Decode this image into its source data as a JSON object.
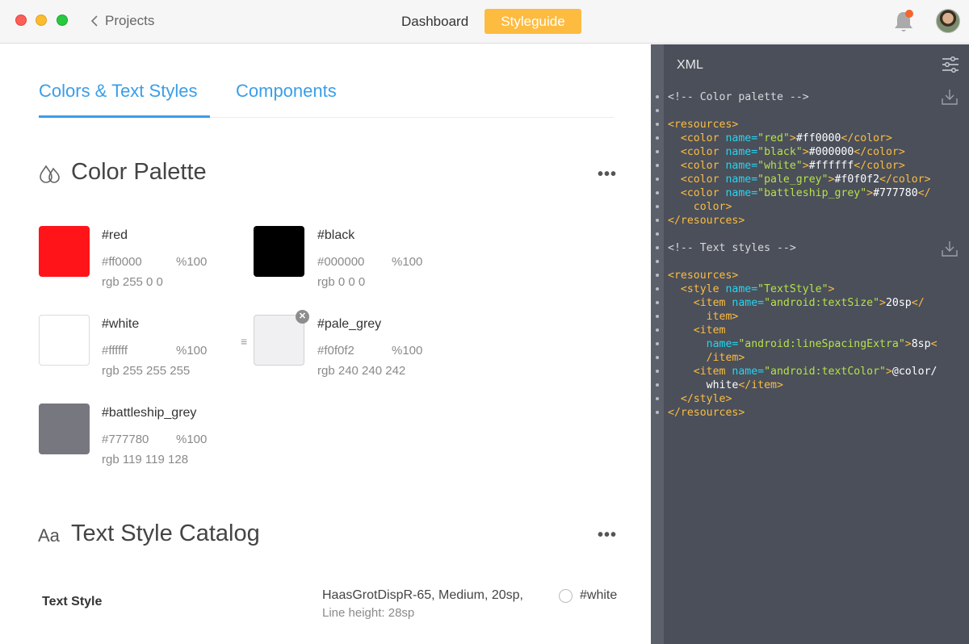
{
  "window": {
    "back_label": "Projects",
    "nav": [
      "Dashboard",
      "Styleguide"
    ]
  },
  "tabs": [
    "Colors & Text Styles",
    "Components"
  ],
  "color_palette": {
    "title": "Color Palette",
    "more": "•••",
    "colors": [
      {
        "name": "#red",
        "hex_label": "#ff0000",
        "opacity": "%100",
        "rgb": "rgb 255 0 0",
        "swatch": "#ff141a"
      },
      {
        "name": "#black",
        "hex_label": "#000000",
        "opacity": "%100",
        "rgb": "rgb 0 0 0",
        "swatch": "#000000"
      },
      {
        "name": "#white",
        "hex_label": "#ffffff",
        "opacity": "%100",
        "rgb": "rgb 255 255 255",
        "swatch": "#ffffff"
      },
      {
        "name": "#pale_grey",
        "hex_label": "#f0f0f2",
        "opacity": "%100",
        "rgb": "rgb 240 240 242",
        "swatch": "#f0f0f2"
      },
      {
        "name": "#battleship_grey",
        "hex_label": "#777780",
        "opacity": "%100",
        "rgb": "rgb 119 119 128",
        "swatch": "#777780"
      }
    ]
  },
  "text_catalog": {
    "title": "Text Style Catalog",
    "icon_text": "Aa",
    "more": "•••",
    "style": {
      "name": "Text Style",
      "font": "HaasGrotDispR-65, Medium, 20sp,",
      "line_height": "Line height: 28sp",
      "color": "#white"
    }
  },
  "xml_panel": {
    "title": "XML",
    "code_lines": [
      [
        [
          "c",
          "<!-- Color palette -->"
        ]
      ],
      [],
      [
        [
          "t",
          "<resources>"
        ]
      ],
      [
        [
          "v",
          "  "
        ],
        [
          "t",
          "<color "
        ],
        [
          "a",
          "name="
        ],
        [
          "s",
          "\"red\""
        ],
        [
          "t",
          ">"
        ],
        [
          "v",
          "#ff0000"
        ],
        [
          "t",
          "</color>"
        ]
      ],
      [
        [
          "v",
          "  "
        ],
        [
          "t",
          "<color "
        ],
        [
          "a",
          "name="
        ],
        [
          "s",
          "\"black\""
        ],
        [
          "t",
          ">"
        ],
        [
          "v",
          "#000000"
        ],
        [
          "t",
          "</color>"
        ]
      ],
      [
        [
          "v",
          "  "
        ],
        [
          "t",
          "<color "
        ],
        [
          "a",
          "name="
        ],
        [
          "s",
          "\"white\""
        ],
        [
          "t",
          ">"
        ],
        [
          "v",
          "#ffffff"
        ],
        [
          "t",
          "</color>"
        ]
      ],
      [
        [
          "v",
          "  "
        ],
        [
          "t",
          "<color "
        ],
        [
          "a",
          "name="
        ],
        [
          "s",
          "\"pale_grey\""
        ],
        [
          "t",
          ">"
        ],
        [
          "v",
          "#f0f0f2"
        ],
        [
          "t",
          "</color>"
        ]
      ],
      [
        [
          "v",
          "  "
        ],
        [
          "t",
          "<color "
        ],
        [
          "a",
          "name="
        ],
        [
          "s",
          "\"battleship_grey\""
        ],
        [
          "t",
          ">"
        ],
        [
          "v",
          "#777780"
        ],
        [
          "t",
          "</"
        ]
      ],
      [
        [
          "v",
          "    "
        ],
        [
          "t",
          "color>"
        ]
      ],
      [
        [
          "t",
          "</resources>"
        ]
      ],
      [],
      [
        [
          "c",
          "<!-- Text styles -->"
        ]
      ],
      [],
      [
        [
          "t",
          "<resources>"
        ]
      ],
      [
        [
          "v",
          "  "
        ],
        [
          "t",
          "<style "
        ],
        [
          "a",
          "name="
        ],
        [
          "s",
          "\"TextStyle\""
        ],
        [
          "t",
          ">"
        ]
      ],
      [
        [
          "v",
          "    "
        ],
        [
          "t",
          "<item "
        ],
        [
          "a",
          "name="
        ],
        [
          "s",
          "\"android:textSize\""
        ],
        [
          "t",
          ">"
        ],
        [
          "v",
          "20sp"
        ],
        [
          "t",
          "</"
        ]
      ],
      [
        [
          "v",
          "      "
        ],
        [
          "t",
          "item>"
        ]
      ],
      [
        [
          "v",
          "    "
        ],
        [
          "t",
          "<item"
        ]
      ],
      [
        [
          "v",
          "      "
        ],
        [
          "a",
          "name="
        ],
        [
          "s",
          "\"android:lineSpacingExtra\""
        ],
        [
          "t",
          ">"
        ],
        [
          "v",
          "8sp"
        ],
        [
          "t",
          "<"
        ]
      ],
      [
        [
          "v",
          "      "
        ],
        [
          "t",
          "/item>"
        ]
      ],
      [
        [
          "v",
          "    "
        ],
        [
          "t",
          "<item "
        ],
        [
          "a",
          "name="
        ],
        [
          "s",
          "\"android:textColor\""
        ],
        [
          "t",
          ">"
        ],
        [
          "v",
          "@color/"
        ]
      ],
      [
        [
          "v",
          "      white"
        ],
        [
          "t",
          "</item>"
        ]
      ],
      [
        [
          "v",
          "  "
        ],
        [
          "t",
          "</style>"
        ]
      ],
      [
        [
          "t",
          "</resources>"
        ]
      ]
    ]
  }
}
